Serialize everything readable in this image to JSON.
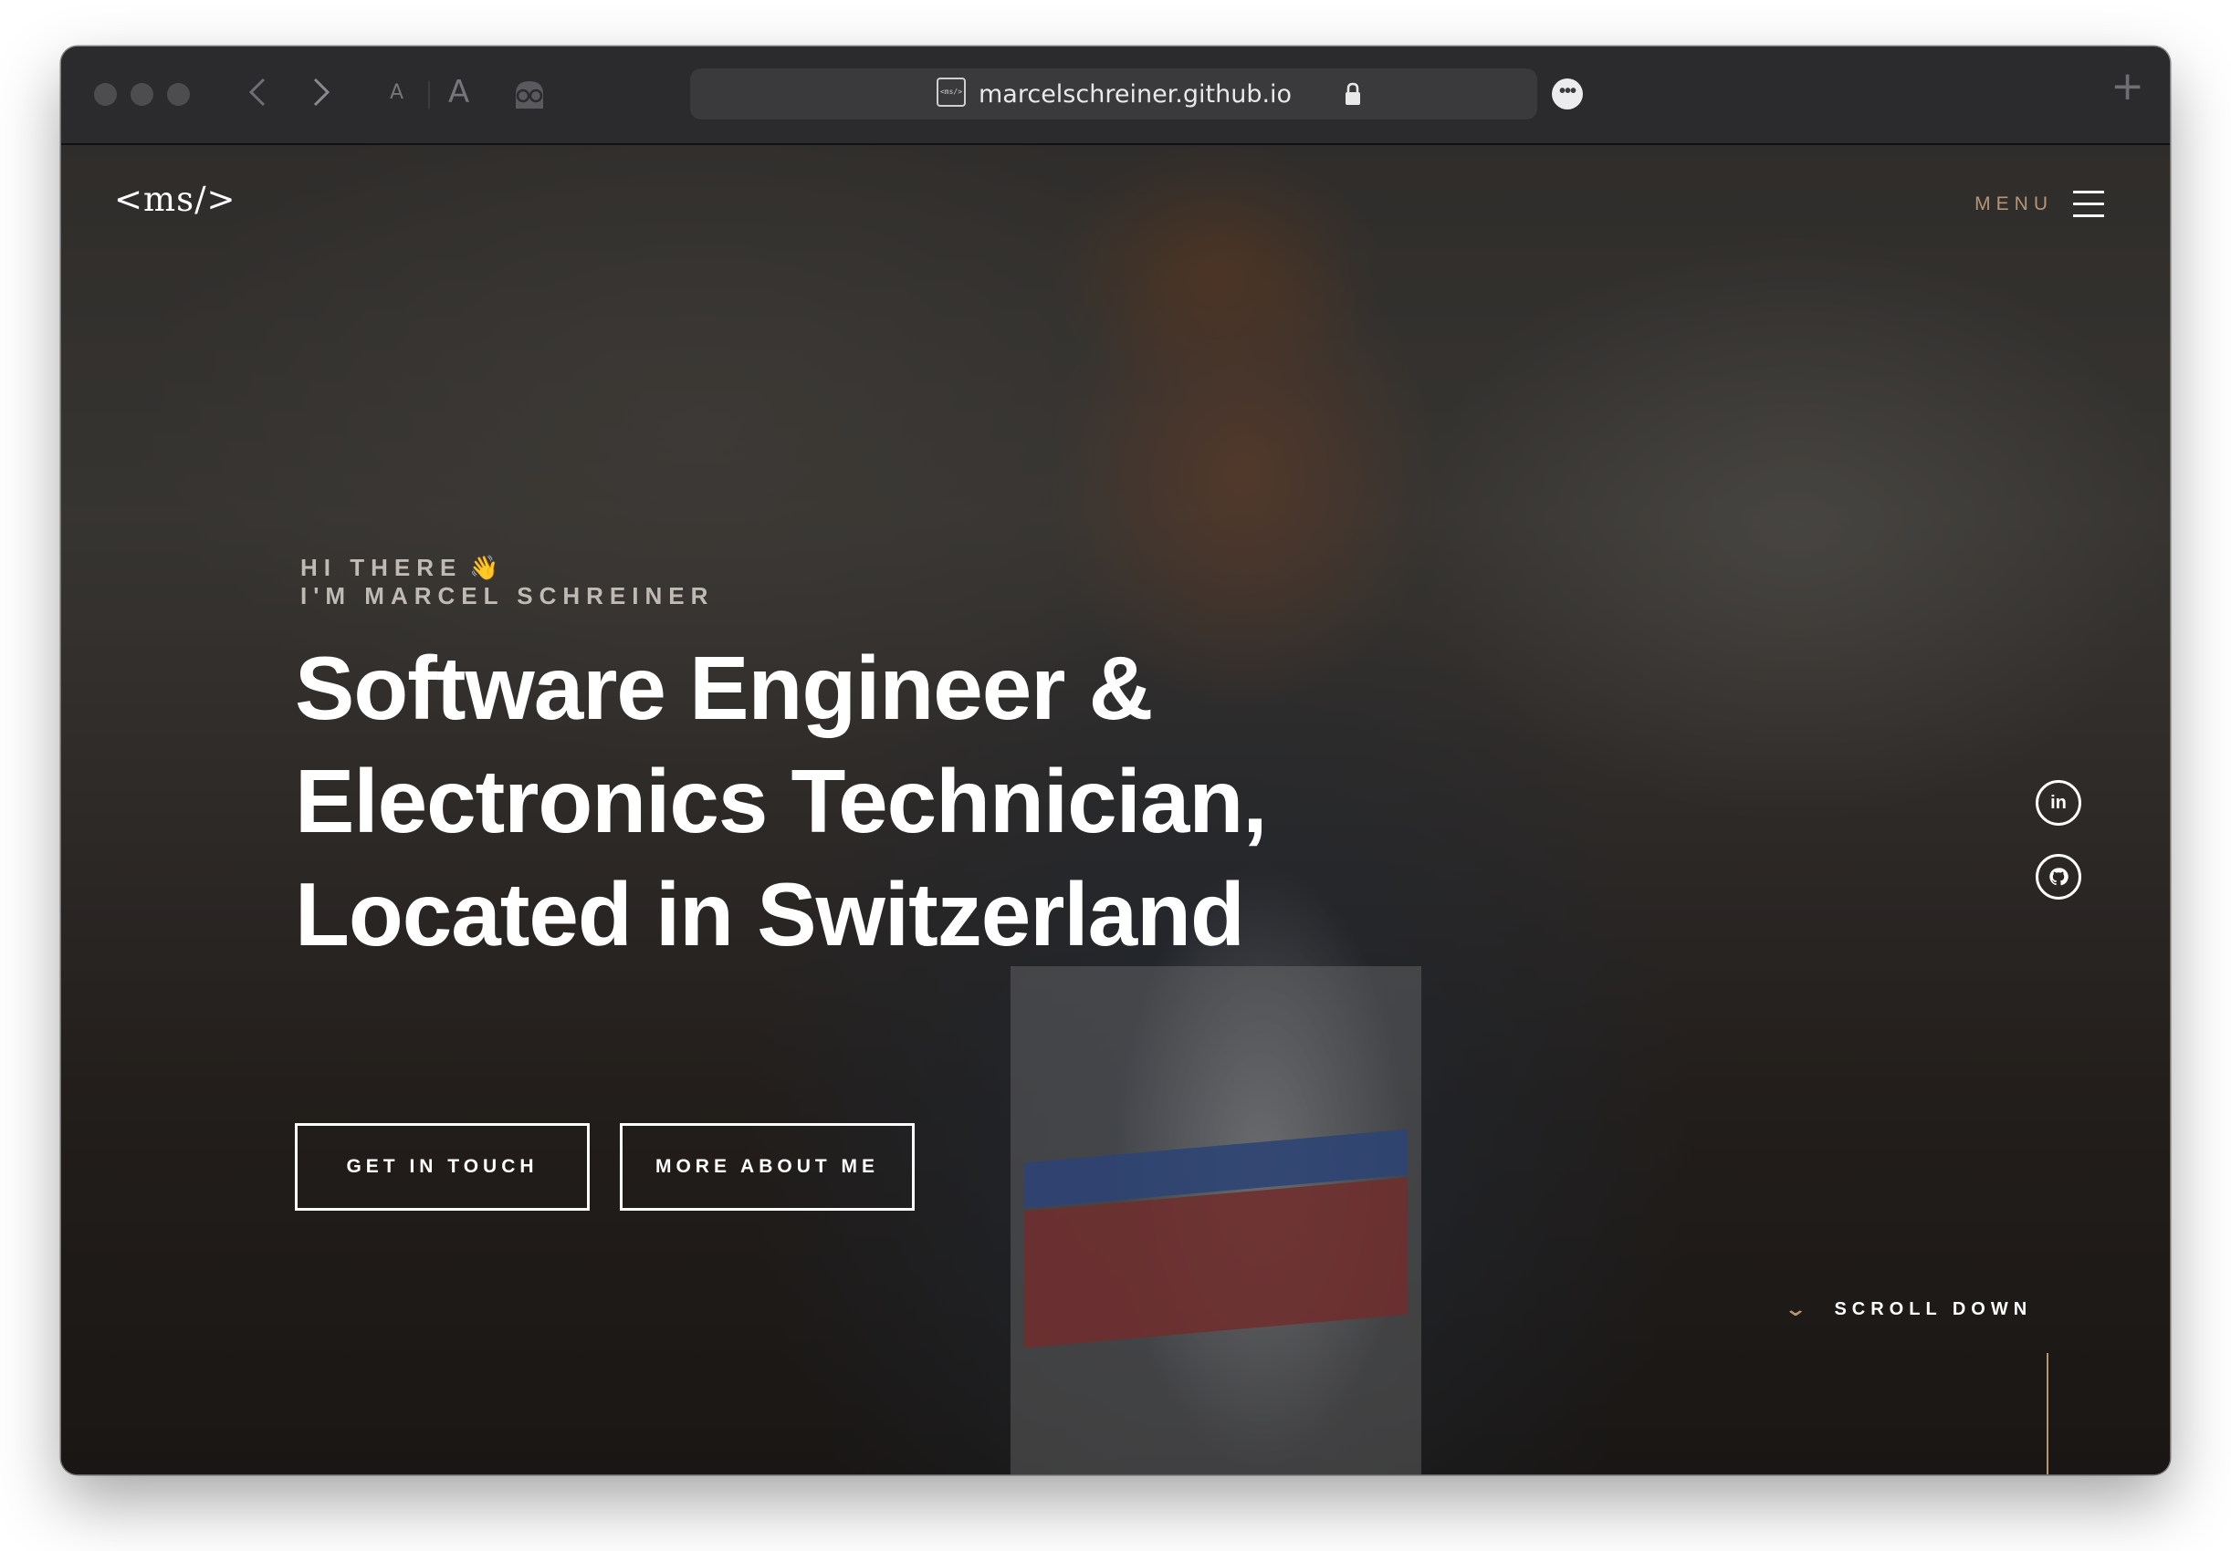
{
  "browser": {
    "url": "marcelschreiner.github.io",
    "favicon_text": "<ms/>",
    "back_icon": "chevron-left-icon",
    "forward_icon": "chevron-right-icon",
    "text_smaller_label": "A",
    "text_larger_label": "A",
    "more_label": "•••",
    "new_tab_label": "+"
  },
  "site": {
    "logo": "<ms/>",
    "menu_label": "MENU",
    "greeting_line1": "HI THERE",
    "greeting_emoji": "👋",
    "greeting_line2": "I'M MARCEL SCHREINER",
    "headline": [
      "Software Engineer &",
      "Electronics Technician,",
      "Located in Switzerland"
    ],
    "buttons": {
      "contact": "GET IN TOUCH",
      "about": "MORE ABOUT ME"
    },
    "social": {
      "linkedin": "in",
      "github_icon": "github-icon"
    },
    "scroll_label": "SCROLL DOWN"
  },
  "colors": {
    "accent": "#b79574",
    "text": "#ffffff",
    "toolbar": "#2b2b2e"
  }
}
